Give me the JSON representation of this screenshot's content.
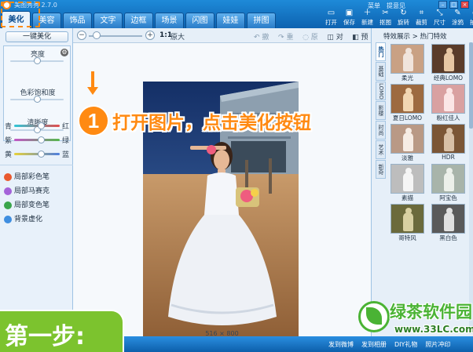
{
  "app": {
    "title": "美图秀秀 2.7.0"
  },
  "tabs": [
    {
      "label": "美化",
      "active": true
    },
    {
      "label": "美容"
    },
    {
      "label": "饰品"
    },
    {
      "label": "文字"
    },
    {
      "label": "边框"
    },
    {
      "label": "场景"
    },
    {
      "label": "闪图"
    },
    {
      "label": "娃娃"
    },
    {
      "label": "拼图"
    }
  ],
  "top_links": {
    "menu": "菜单",
    "feedback": "提意见"
  },
  "quick_tools": [
    {
      "label": "打开",
      "icon": "open-icon"
    },
    {
      "label": "保存",
      "icon": "save-icon"
    },
    {
      "label": "新建",
      "icon": "new-icon"
    },
    {
      "label": "抠图",
      "icon": "cutout-icon"
    },
    {
      "label": "旋转",
      "icon": "rotate-icon"
    },
    {
      "label": "裁剪",
      "icon": "crop-icon"
    },
    {
      "label": "尺寸",
      "icon": "resize-icon"
    },
    {
      "label": "涂鸦",
      "icon": "doodle-icon"
    },
    {
      "label": "拍照",
      "icon": "camera-icon"
    }
  ],
  "left_panel": {
    "oneclick_label": "一键美化",
    "brightness_label": "亮度",
    "saturation_label": "色彩饱和度",
    "sharpness_label": "清晰度",
    "color_rows": [
      {
        "left": "青",
        "right": "红"
      },
      {
        "left": "紫",
        "right": "绿"
      },
      {
        "left": "黄",
        "right": "蓝"
      }
    ],
    "local_tools": [
      {
        "label": "局部彩色笔"
      },
      {
        "label": "局部马赛克"
      },
      {
        "label": "局部变色笔"
      },
      {
        "label": "背景虚化"
      }
    ]
  },
  "canvas_toolbar": {
    "zoom_ratio": "1:1",
    "zoom_orig": "原大",
    "actions": [
      "撤销",
      "重做",
      "原图",
      "对比",
      "预览"
    ]
  },
  "canvas": {
    "image_size": "516 × 800"
  },
  "annotation": {
    "step_number": "1",
    "step_text": "打开图片，点击美化按钮",
    "step_banner": "第一步:"
  },
  "right_panel": {
    "breadcrumb": "特效展示 > 热门特效",
    "side_tabs": [
      "热门",
      "基础",
      "LOMO",
      "影楼",
      "时尚",
      "艺术",
      "新奇"
    ],
    "effects": [
      {
        "label": "柔光",
        "bg": "#c9a184",
        "fig": "#f0e4dc"
      },
      {
        "label": "经典LOMO",
        "bg": "#5a3c2a",
        "fig": "#e7c7a4"
      },
      {
        "label": "夏日LOMO",
        "bg": "#9d6a40",
        "fig": "#f2d6b2"
      },
      {
        "label": "粉红佳人",
        "bg": "#d9a1a1",
        "fig": "#fbe6e6"
      },
      {
        "label": "淡雅",
        "bg": "#b99985",
        "fig": "#f6ece4"
      },
      {
        "label": "HDR",
        "bg": "#7b5636",
        "fig": "#d8c0a6"
      },
      {
        "label": "素描",
        "bg": "#bdbdbd",
        "fig": "#f5f5f5"
      },
      {
        "label": "阿宝色",
        "bg": "#a8b4aa",
        "fig": "#ecf0ea"
      },
      {
        "label": "哥特风",
        "bg": "#6b6a3c",
        "fig": "#d8d0a2"
      },
      {
        "label": "黑白色",
        "bg": "#5a5a5a",
        "fig": "#e0e0e0"
      }
    ]
  },
  "statusbar": {
    "links": [
      "发到微博",
      "发到相册",
      "DIY礼物",
      "照片冲印"
    ]
  },
  "watermark": {
    "brand": "绿茶软件园",
    "url": "www.33LC.com"
  }
}
